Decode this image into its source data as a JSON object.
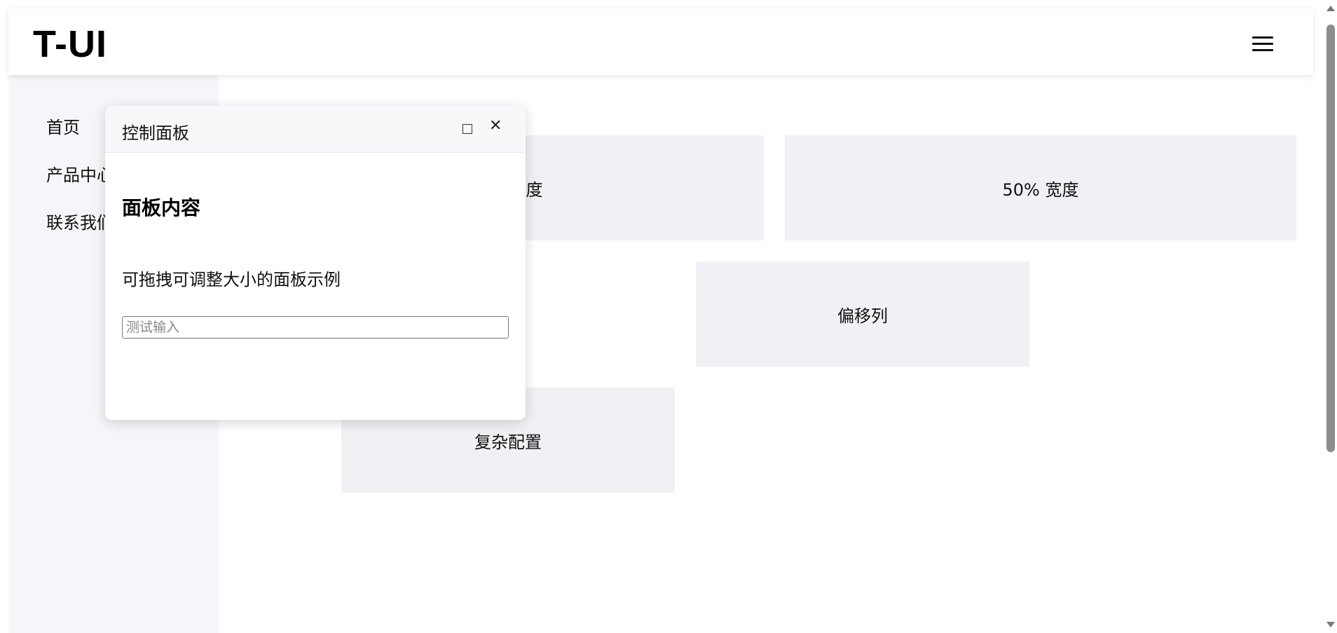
{
  "header": {
    "logo": "T-UI",
    "menu_icon": "hamburger-menu-icon"
  },
  "sidebar": {
    "items": [
      {
        "label": "首页"
      },
      {
        "label": "产品中心"
      },
      {
        "label": "联系我们"
      }
    ]
  },
  "grid": {
    "cells": [
      {
        "label": "50% 宽度"
      },
      {
        "label": "50% 宽度"
      },
      {
        "label": "偏移列"
      },
      {
        "label": "复杂配置"
      }
    ]
  },
  "panel": {
    "title": "控制面板",
    "maximize_icon": "maximize-icon",
    "close_icon": "close-icon",
    "close_glyph": "✕",
    "heading": "面板内容",
    "description": "可拖拽可调整大小的面板示例",
    "input": {
      "placeholder": "测试输入",
      "value": ""
    }
  },
  "colors": {
    "sidebar_bg": "#f5f6f9",
    "cell_bg": "#f0f1f4",
    "panel_head_bg": "#f7f8fa"
  }
}
